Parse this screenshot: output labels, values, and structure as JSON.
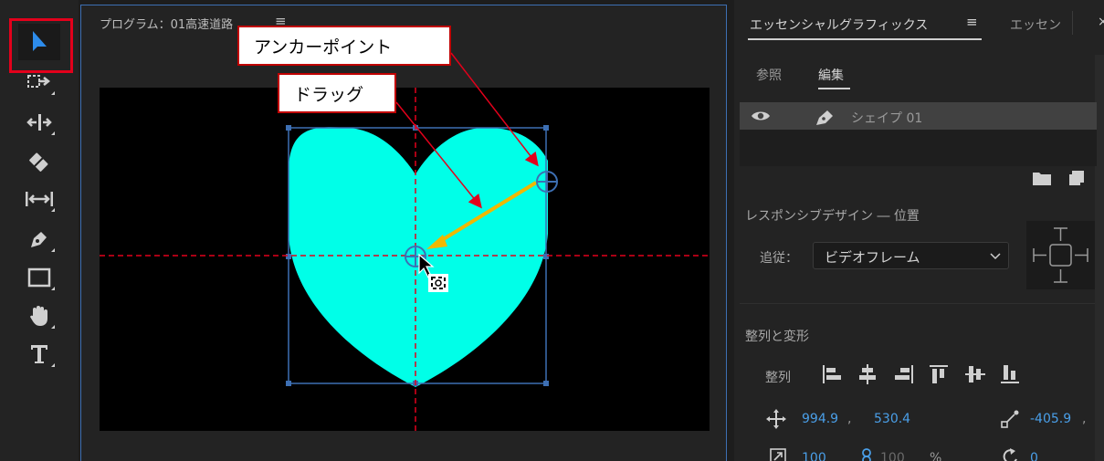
{
  "toolbar": {
    "tools": [
      {
        "name": "selection-tool",
        "icon": "arrow-pointer-icon",
        "selected": true
      },
      {
        "name": "track-select-tool",
        "icon": "track-select-icon"
      },
      {
        "name": "ripple-edit-tool",
        "icon": "ripple-edit-icon"
      },
      {
        "name": "razor-tool",
        "icon": "razor-icon"
      },
      {
        "name": "slip-tool",
        "icon": "slip-icon"
      },
      {
        "name": "pen-tool",
        "icon": "pen-icon"
      },
      {
        "name": "rectangle-tool",
        "icon": "rectangle-icon"
      },
      {
        "name": "hand-tool",
        "icon": "hand-icon"
      },
      {
        "name": "type-tool",
        "icon": "type-icon"
      }
    ],
    "highlight_color": "#e3001b",
    "accent_color": "#2d8ceb"
  },
  "program": {
    "title": "プログラム：01高速道路",
    "menu_icon": "≡"
  },
  "callouts": {
    "anchor_point": "アンカーポイント",
    "drag": "ドラッグ"
  },
  "canvas": {
    "shape_color": "#00ffe8",
    "guide_color": "#e3001b",
    "arrow_color": "#f0b800",
    "bbox_color": "#3d6fb3"
  },
  "essential_graphics": {
    "tab_active": "エッセンシャルグラフィックス",
    "tab_menu": "≡",
    "tab_other": "エッセン",
    "close": "×",
    "subtab_browse": "参照",
    "subtab_edit": "編集",
    "layer_name": "シェイプ 01",
    "responsive_label": "レスポンシブデザイン ― 位置",
    "follow_label": "追従：",
    "follow_value": "ビデオフレーム",
    "align_transform_label": "整列と変形",
    "align_label": "整列",
    "position_x": "994.9",
    "position_y": "530.4",
    "anchor_x": "-405.9",
    "scale_value": "100",
    "scale_value_2": "100",
    "scale_unit": "%",
    "rotation_value": "0",
    "comma": ","
  }
}
